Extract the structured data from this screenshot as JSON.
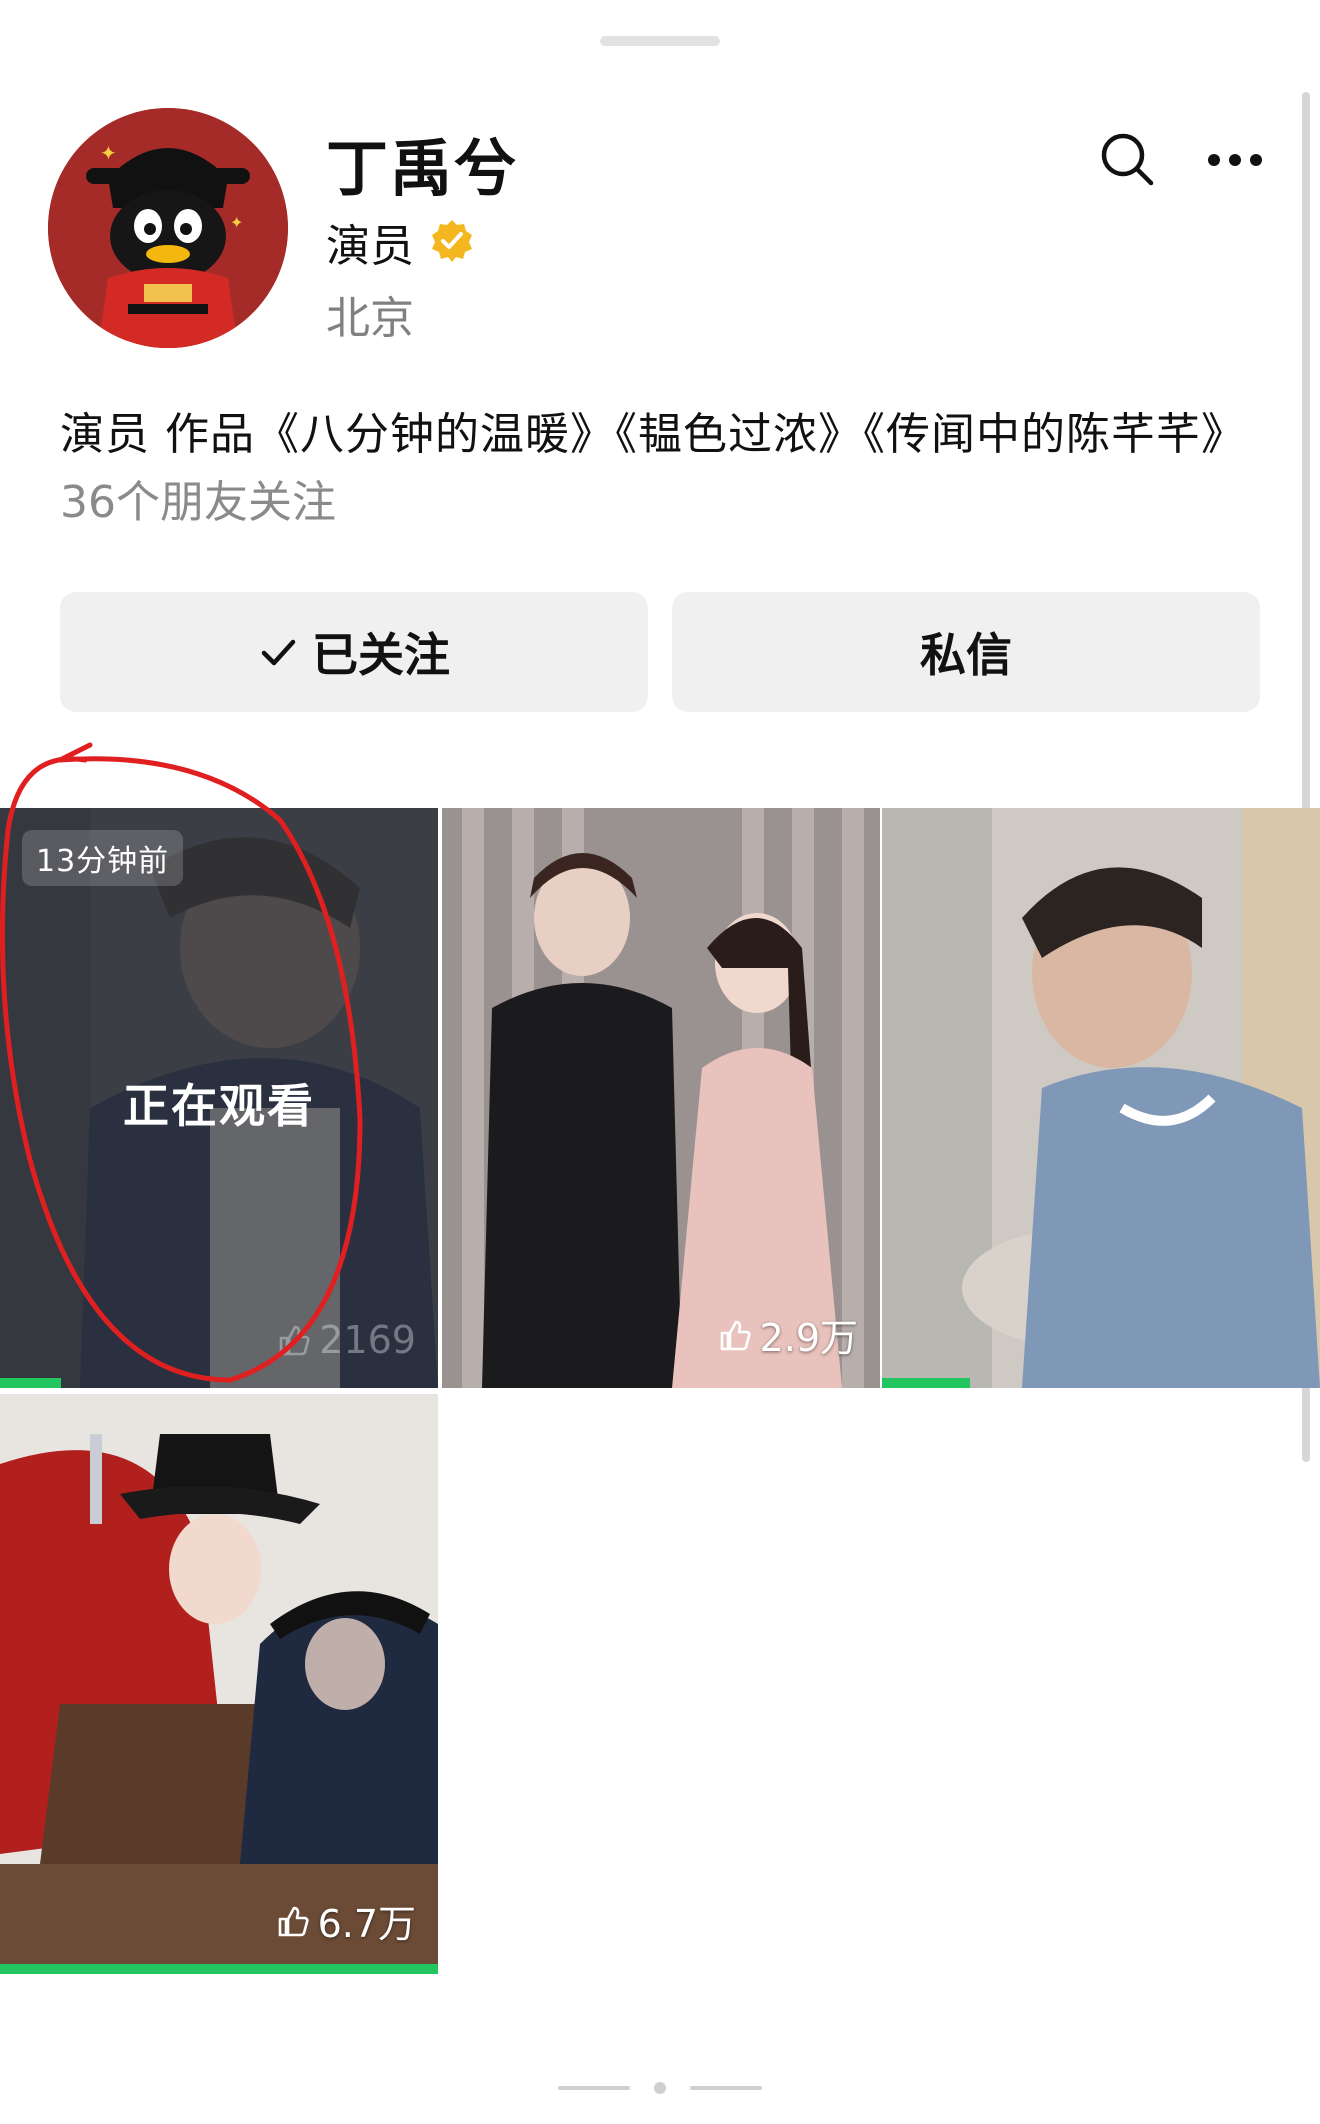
{
  "profile": {
    "name": "丁禹兮",
    "role": "演员",
    "location": "北京",
    "bio": "演员 作品《八分钟的温暖》《韫色过浓》《传闻中的陈芊芊》",
    "friends_following": "36个朋友关注",
    "verified_color": "#f5b71f"
  },
  "header_icons": [
    "search-icon",
    "more-icon"
  ],
  "actions": {
    "follow_label": "已关注",
    "message_label": "私信"
  },
  "videos": [
    {
      "time_badge": "13分钟前",
      "status": "正在观看",
      "likes": "2169",
      "watched_fraction": 0.14
    },
    {
      "likes": "2.9万"
    },
    {
      "likes": "",
      "watched_fraction": 0.2
    },
    {
      "likes": "6.7万",
      "watched_fraction": 1.0
    }
  ],
  "colors": {
    "progress": "#22c55e",
    "annotation": "#e02020"
  }
}
